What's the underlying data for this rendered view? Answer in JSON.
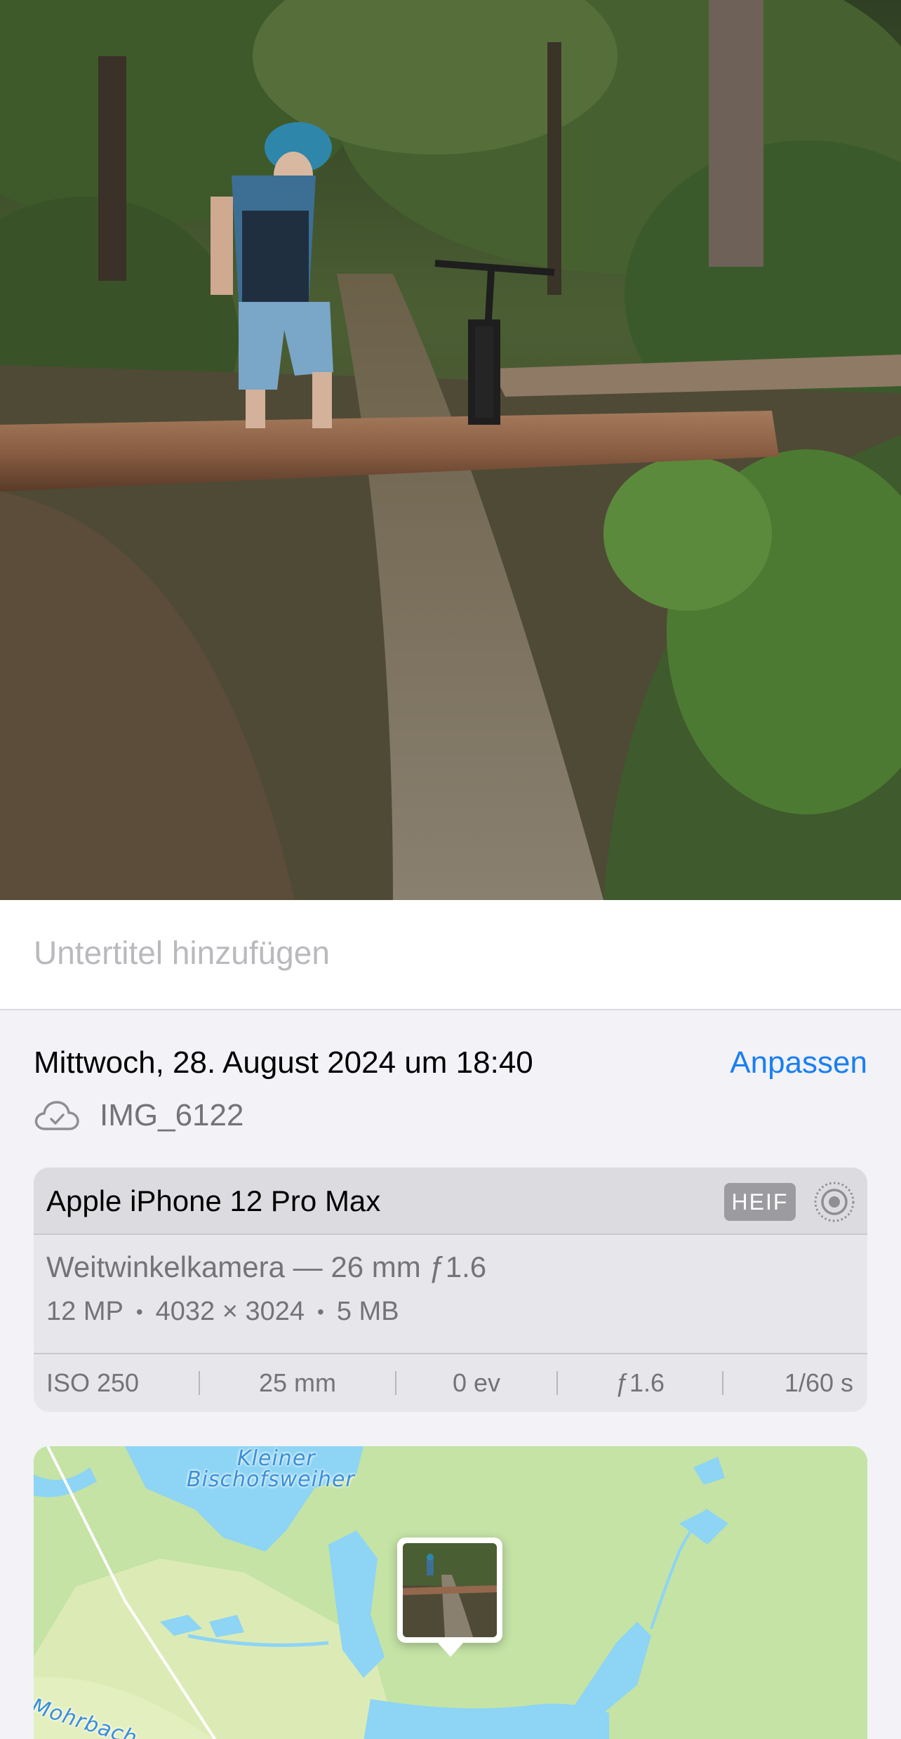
{
  "photo": {
    "alt": "Mountainbiker an einem umgestürzten Baumstamm auf einem Waldweg"
  },
  "caption": {
    "placeholder": "Untertitel hinzufügen"
  },
  "info": {
    "date": "Mittwoch, 28. August 2024 um 18:40",
    "adjust_label": "Anpassen",
    "cloud_icon": "icloud-icon",
    "filename": "IMG_6122"
  },
  "camera": {
    "model": "Apple iPhone 12 Pro Max",
    "format_badge": "HEIF",
    "live_icon": "live-photo-icon",
    "lens": "Weitwinkelkamera — 26 mm ƒ1.6",
    "resolution": "12 MP",
    "dimensions": "4032 × 3024",
    "filesize": "5 MB",
    "exif": {
      "iso": "ISO 250",
      "focal": "25 mm",
      "ev": "0 ev",
      "aperture": "ƒ1.6",
      "shutter": "1/60 s"
    }
  },
  "map": {
    "lake_label_1": "Kleiner",
    "lake_label_2": "Bischofsweiher",
    "stream_label": "Mohrbach"
  },
  "colors": {
    "accent": "#1a7ff0",
    "map_land": "#c4e3a5",
    "map_water": "#8dd4f5"
  }
}
